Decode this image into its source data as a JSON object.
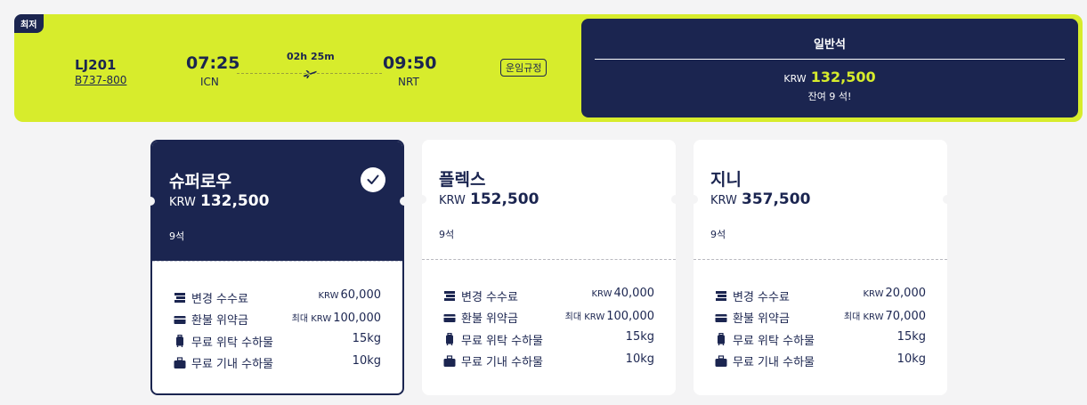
{
  "flight": {
    "badge": "최저",
    "flight_no": "LJ201",
    "aircraft": "B737-800",
    "dep_time": "07:25",
    "dep_airport": "ICN",
    "arr_time": "09:50",
    "arr_airport": "NRT",
    "duration": "02h 25m",
    "rules_label": "운임규정"
  },
  "class_panel": {
    "title": "일반석",
    "currency": "KRW",
    "price": "132,500",
    "seats": "잔여 9 석!"
  },
  "fares": [
    {
      "name": "슈퍼로우",
      "currency": "KRW",
      "price": "132,500",
      "seats": "9석",
      "selected": true,
      "rows": [
        {
          "label": "변경 수수료",
          "prefix": "KRW",
          "value": "60,000"
        },
        {
          "label": "환불 위약금",
          "prefix": "최대 KRW",
          "value": "100,000"
        },
        {
          "label": "무료 위탁 수하물",
          "prefix": "",
          "value": "15kg"
        },
        {
          "label": "무료 기내 수하물",
          "prefix": "",
          "value": "10kg"
        }
      ]
    },
    {
      "name": "플렉스",
      "currency": "KRW",
      "price": "152,500",
      "seats": "9석",
      "selected": false,
      "rows": [
        {
          "label": "변경 수수료",
          "prefix": "KRW",
          "value": "40,000"
        },
        {
          "label": "환불 위약금",
          "prefix": "최대 KRW",
          "value": "100,000"
        },
        {
          "label": "무료 위탁 수하물",
          "prefix": "",
          "value": "15kg"
        },
        {
          "label": "무료 기내 수하물",
          "prefix": "",
          "value": "10kg"
        }
      ]
    },
    {
      "name": "지니",
      "currency": "KRW",
      "price": "357,500",
      "seats": "9석",
      "selected": false,
      "rows": [
        {
          "label": "변경 수수료",
          "prefix": "KRW",
          "value": "20,000"
        },
        {
          "label": "환불 위약금",
          "prefix": "최대 KRW",
          "value": "70,000"
        },
        {
          "label": "무료 위탁 수하물",
          "prefix": "",
          "value": "15kg"
        },
        {
          "label": "무료 기내 수하물",
          "prefix": "",
          "value": "10kg"
        }
      ]
    }
  ],
  "colors": {
    "accent": "#d7ec2c",
    "navy": "#1b2550",
    "background": "#f4f4f5"
  },
  "row_icons": [
    "change-fee-icon",
    "refund-card-icon",
    "checked-luggage-icon",
    "carry-on-bag-icon"
  ]
}
